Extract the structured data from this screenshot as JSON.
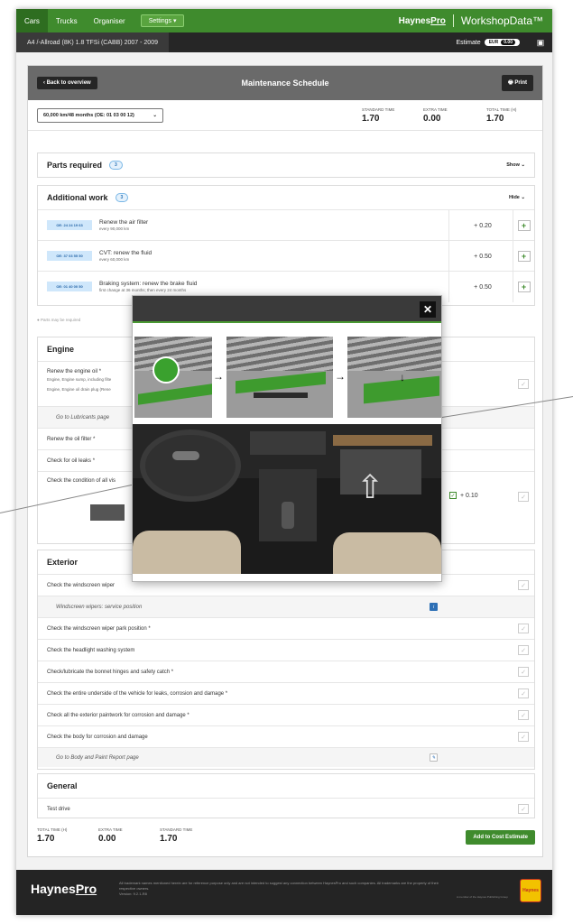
{
  "nav": {
    "tabs": [
      "Cars",
      "Trucks",
      "Organiser"
    ],
    "settings_label": "Settings",
    "brand_haynes": "Haynes",
    "brand_pro": "Pro",
    "brand_workshopdata": "WorkshopData™"
  },
  "vehicle": {
    "title": "A4 /-Allroad (8K) 1.8 TFSi (CABB) 2007 - 2009",
    "estimate_label": "Estimate",
    "estimate_currency": "EUR",
    "estimate_value": "0.00"
  },
  "header": {
    "back_label": "Back to overview",
    "title": "Maintenance Schedule",
    "print_label": "Print"
  },
  "interval": {
    "selected": "60,000 km/48 months (OE: 01 03 00 12)"
  },
  "times": {
    "standard_label": "STANDARD TIME",
    "standard_value": "1.70",
    "extra_label": "EXTRA TIME",
    "extra_value": "0.00",
    "total_label": "TOTAL TIME (H)",
    "total_value": "1.70"
  },
  "parts": {
    "title": "Parts required",
    "count": "3",
    "toggle": "Show"
  },
  "additional": {
    "title": "Additional work",
    "count": "3",
    "toggle": "Hide",
    "items": [
      {
        "code": "OE: 24 24 19 63",
        "title": "Renew the air filter",
        "sub": "every 90,000 km",
        "time": "+ 0.20"
      },
      {
        "code": "OE: 37 03 55 50",
        "title": "CVT: renew the fluid",
        "sub": "every 60,000 km",
        "time": "+ 0.50"
      },
      {
        "code": "OE: 01 40 00 50",
        "title": "Braking system: renew the brake fluid",
        "sub": "first change at 36 months; then every 24 months",
        "time": "+ 0.50"
      }
    ],
    "note": "Parts may be required"
  },
  "engine": {
    "title": "Engine",
    "oil_title": "Renew the engine oil",
    "oil_sub1": "Engine, Engine sump, including filte",
    "oil_sub2": "Engine, Engine oil drain plug (Rene",
    "lubricants_link": "Go to Lubricants page",
    "oil_filter": "Renew the oil filter",
    "oil_leaks": "Check for oil leaks",
    "condition": "Check the condition of all vis",
    "condition_time": "+ 0.10"
  },
  "exterior": {
    "title": "Exterior",
    "wiper": "Check the windscreen wiper",
    "wiper_service": "Windscreen wipers: service position",
    "rows": [
      "Check the windscreen wiper park position",
      "Check the headlight washing system",
      "Check/lubricate the bonnet hinges and safety catch",
      "Check the entire underside of the vehicle for leaks, corrosion and damage",
      "Check all the exterior paintwork for corrosion and damage",
      "Check the body for corrosion and damage"
    ],
    "paint_link": "Go to Body and Paint Report page"
  },
  "general": {
    "title": "General",
    "test_drive": "Test drive"
  },
  "footer_totals": {
    "total_label": "TOTAL TIME (H)",
    "total_value": "1.70",
    "extra_label": "EXTRA TIME",
    "extra_value": "0.00",
    "standard_label": "STANDARD TIME",
    "standard_value": "1.70",
    "add_label": "Add to Cost Estimate"
  },
  "footer": {
    "brand_haynes": "Haynes",
    "brand_pro": "Pro",
    "disclaimer": "All trademark names mentioned herein are for reference purpose only and are not intended to suggest any connection between HaynesPro and such companies. All trademarks are the property of their respective owners.",
    "version": "Version: 9.2.1-R8",
    "parent": "A member of the Haynes Publishing Group",
    "logo_text": "Haynes"
  },
  "modal": {
    "close_symbol": "✕"
  },
  "colors": {
    "nav_green": "#3f8b2d",
    "vehicle_bar": "#262626",
    "header_grey": "#6a6a6a",
    "code_badge": "#cfe7fb"
  }
}
